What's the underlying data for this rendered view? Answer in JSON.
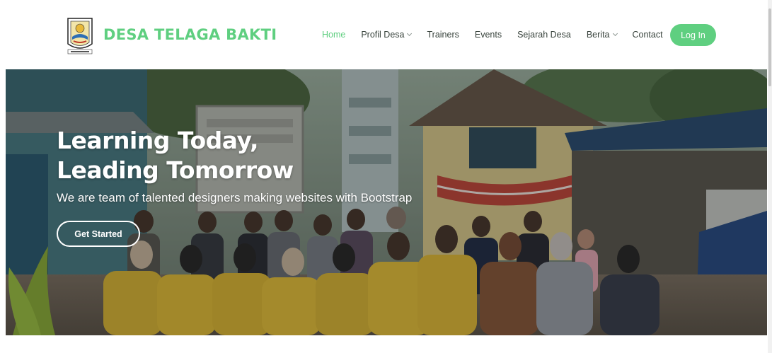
{
  "brand": {
    "name": "DESA TELAGA BAKTI",
    "logo_icon": "village-emblem-icon"
  },
  "nav": {
    "items": [
      {
        "label": "Home",
        "active": true
      },
      {
        "label": "Profil Desa",
        "dropdown": true
      },
      {
        "label": "Trainers"
      },
      {
        "label": "Events"
      },
      {
        "label": "Sejarah Desa"
      },
      {
        "label": "Berita",
        "dropdown": true
      },
      {
        "label": "Contact"
      }
    ],
    "login_label": "Log In"
  },
  "hero": {
    "title_line1": "Learning Today,",
    "title_line2": "Leading Tomorrow",
    "subtitle": "We are team of talented designers making websites with Bootstrap",
    "cta_label": "Get Started",
    "background": "group-photo-village-office"
  },
  "colors": {
    "accent": "#5fcf80",
    "text": "#37423b"
  }
}
